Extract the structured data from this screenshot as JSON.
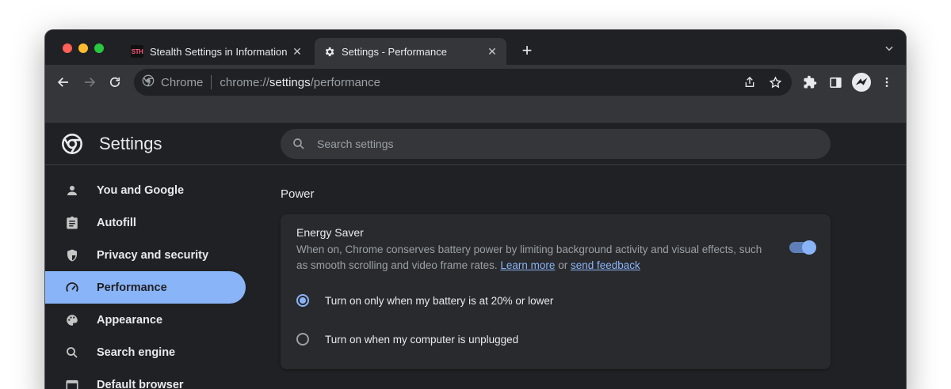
{
  "tabs": [
    {
      "favicon": "STH",
      "title": "Stealth Settings in Information",
      "close": "✕",
      "active": false
    },
    {
      "favicon": "gear-icon",
      "title": "Settings - Performance",
      "close": "✕",
      "active": true
    }
  ],
  "new_tab_label": "+",
  "omnibox": {
    "site_label": "Chrome",
    "url_scheme": "chrome://",
    "url_host": "settings",
    "url_path": "/performance"
  },
  "settings": {
    "title": "Settings",
    "search_placeholder": "Search settings",
    "sidebar": [
      {
        "label": "You and Google",
        "icon": "person-icon",
        "active": false
      },
      {
        "label": "Autofill",
        "icon": "clipboard-icon",
        "active": false
      },
      {
        "label": "Privacy and security",
        "icon": "shield-icon",
        "active": false
      },
      {
        "label": "Performance",
        "icon": "speedometer-icon",
        "active": true
      },
      {
        "label": "Appearance",
        "icon": "palette-icon",
        "active": false
      },
      {
        "label": "Search engine",
        "icon": "search-icon",
        "active": false
      },
      {
        "label": "Default browser",
        "icon": "browser-icon",
        "active": false
      }
    ],
    "section_title": "Power",
    "energy_saver": {
      "title": "Energy Saver",
      "description": "When on, Chrome conserves battery power by limiting background activity and visual effects, such as smooth scrolling and video frame rates.",
      "learn_more": "Learn more",
      "or_text": "or",
      "send_feedback": "send feedback",
      "enabled": true,
      "options": [
        {
          "label": "Turn on only when my battery is at 20% or lower",
          "checked": true
        },
        {
          "label": "Turn on when my computer is unplugged",
          "checked": false
        }
      ]
    }
  },
  "colors": {
    "accent": "#8ab4f8",
    "background": "#202124",
    "toolbar": "#35363a"
  }
}
